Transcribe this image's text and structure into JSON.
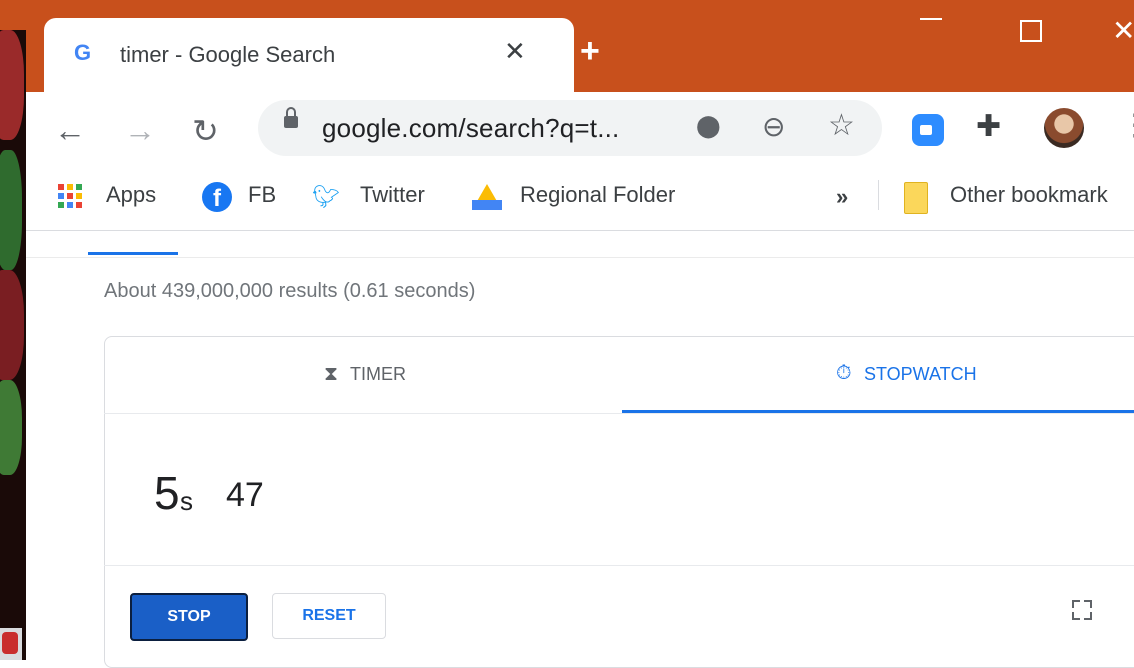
{
  "browser": {
    "tab_title": "timer - Google Search",
    "tab_favicon": "G",
    "tab_close": "✕",
    "new_tab": "+",
    "window_close": "✕"
  },
  "toolbar": {
    "url": "google.com/search?q=t...",
    "icons": [
      "back-arrow-icon",
      "forward-arrow-icon",
      "reload-icon",
      "lock-icon",
      "location-icon",
      "zoom-out-icon",
      "star-icon",
      "zoom-extension-icon",
      "puzzle-icon",
      "avatar",
      "menu-icon"
    ]
  },
  "bookmarks": {
    "apps": "Apps",
    "fb": "FB",
    "twitter": "Twitter",
    "regional_folder": "Regional Folder",
    "more": "»",
    "other": "Other bookmark"
  },
  "search": {
    "result_stats": "About 439,000,000 results (0.61 seconds)"
  },
  "stopwatch": {
    "tab_timer": "TIMER",
    "tab_stopwatch": "STOPWATCH",
    "active_tab": "STOPWATCH",
    "seconds": "5",
    "seconds_unit": "s",
    "hundredths": "47",
    "stop_label": "STOP",
    "reset_label": "RESET"
  },
  "colors": {
    "titlebar": "#c8501c",
    "accent": "#1a73e8",
    "stop_button": "#1a5fc7"
  }
}
